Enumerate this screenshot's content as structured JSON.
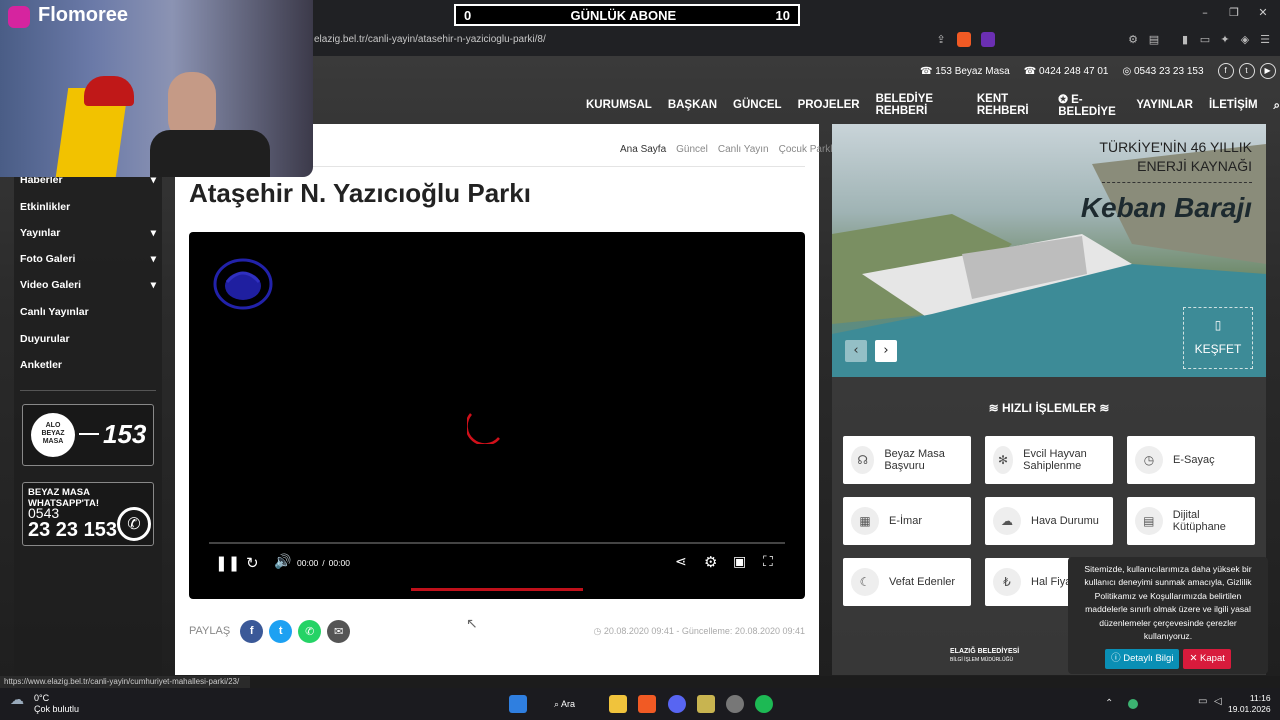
{
  "overlay": {
    "brand": "Flomoree",
    "subscriber_left": "0",
    "subscriber_title": "GÜNLÜK ABONE",
    "subscriber_right": "10"
  },
  "browser": {
    "url": "elazig.bel.tr/canli-yayin/atasehir-n-yazicioglu-parki/8/",
    "status_url": "https://www.elazig.bel.tr/canli-yayin/cumhuriyet-mahallesi-parki/23/"
  },
  "topbar": {
    "phone1": "153 Beyaz Masa",
    "phone2": "0424 248 47 01",
    "phone3": "0543 23 23 153"
  },
  "nav": [
    "KURUMSAL",
    "BAŞKAN",
    "GÜNCEL",
    "PROJELER",
    "BELEDİYE REHBERİ",
    "KENT REHBERİ",
    "E-BELEDİYE",
    "YAYINLAR",
    "İLETİŞİM"
  ],
  "sidebar": {
    "items": [
      "Haberler",
      "Etkinlikler",
      "Yayınlar",
      "Foto Galeri",
      "Video Galeri",
      "Canlı Yayınlar",
      "Duyurular",
      "Anketler"
    ],
    "alo_top": "ALO",
    "alo_mid": "BEYAZ",
    "alo_bot": "MASA",
    "alo_num": "153",
    "wa_title": "BEYAZ MASA WHATSAPP'TA!",
    "wa_prefix": "0543",
    "wa_num": "23 23 153"
  },
  "breadcrumb": [
    "Ana Sayfa",
    "Güncel",
    "Canlı Yayın",
    "Çocuk Parkları"
  ],
  "page_title": "Ataşehir N. Yazıcıoğlu Parkı",
  "player": {
    "time_current": "00:00",
    "time_sep": "/",
    "time_total": "00:00"
  },
  "share": {
    "label": "PAYLAŞ",
    "date": "20.08.2020 09:41 - Güncelleme: 20.08.2020 09:41"
  },
  "hero": {
    "line1": "TÜRKİYE'NİN 46 YILLIK",
    "line2": "ENERJİ KAYNAĞI",
    "name": "Keban Barajı",
    "explore": "KEŞFET"
  },
  "quick": {
    "title": "HIZLI İŞLEMLER",
    "items": [
      "Beyaz Masa Başvuru",
      "Evcil Hayvan Sahiplenme",
      "E-Sayaç",
      "E-İmar",
      "Hava Durumu",
      "Dijital Kütüphane",
      "Vefat Edenler",
      "Hal Fiyatları"
    ],
    "footer": "ELAZIĞ BELEDİYESİ",
    "footer_sub": "BİLGİ İŞLEM MÜDÜRLÜĞÜ"
  },
  "cookie": {
    "text": "Sitemizde, kullanıcılarımıza daha yüksek bir kullanıcı deneyimi sunmak amacıyla, Gizlilik Politikamız ve Koşullarımızda belirtilen maddelerle sınırlı olmak üzere ve ilgili yasal düzenlemeler çerçevesinde çerezler kullanıyoruz.",
    "detail_btn": "Detaylı Bilgi",
    "close_btn": "Kapat"
  },
  "taskbar": {
    "temp": "0°C",
    "weather": "Çok bulutlu",
    "search": "Ara",
    "time": "11:16",
    "date": "19.01.2026"
  }
}
